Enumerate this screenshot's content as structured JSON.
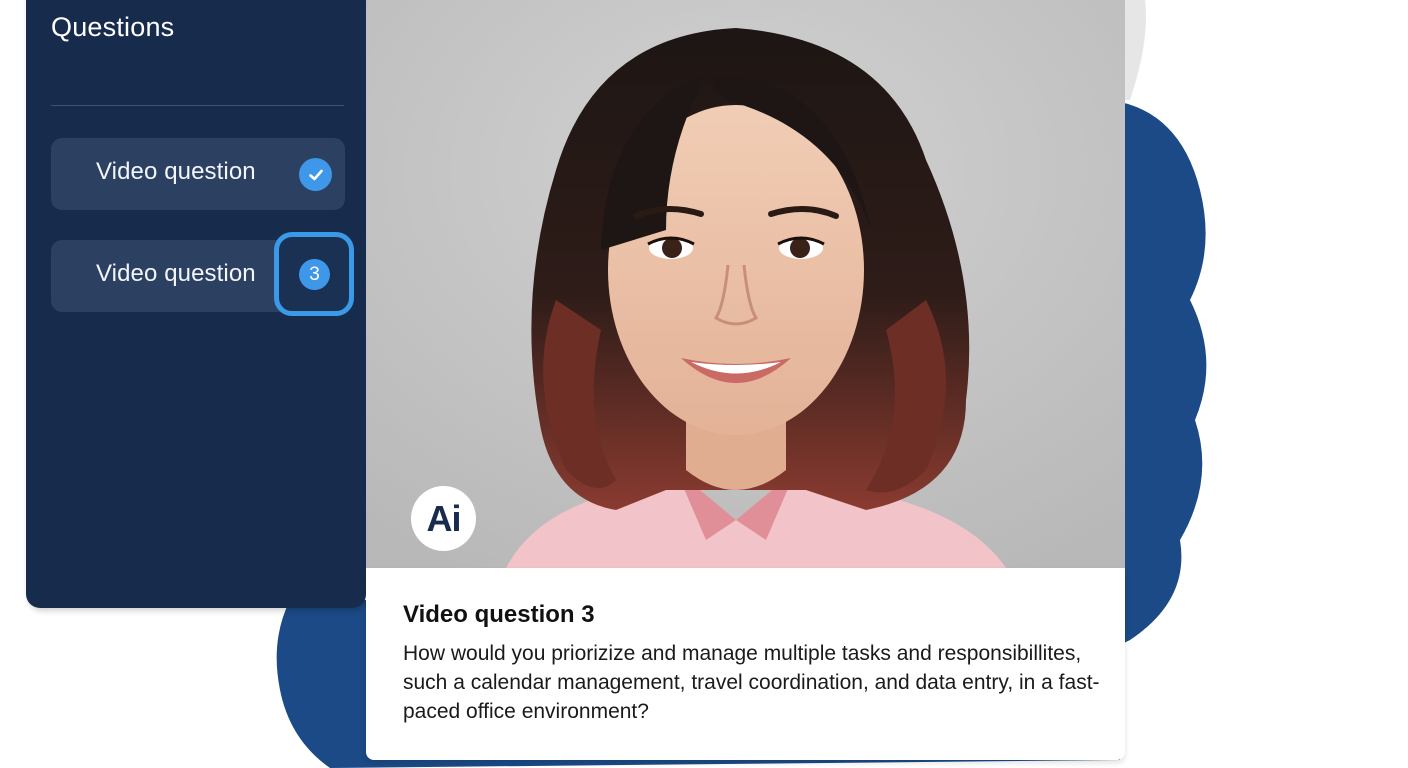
{
  "sidebar": {
    "title": "Questions",
    "items": [
      {
        "label": "Video question",
        "status": "completed",
        "status_icon": "check-icon"
      },
      {
        "label": "Video question",
        "status": "current",
        "number": "3"
      }
    ]
  },
  "video": {
    "ai_badge": "Ai"
  },
  "question": {
    "title": "Video question 3",
    "text": "How would you priorizize and manage multiple tasks and responsibillites, such a calendar management, travel coordination, and data entry, in a fast-paced office environment?"
  },
  "colors": {
    "sidebar_bg": "#172b4d",
    "item_bg": "#2c4061",
    "accent": "#3e97e8",
    "brush": "#1c4a86"
  }
}
